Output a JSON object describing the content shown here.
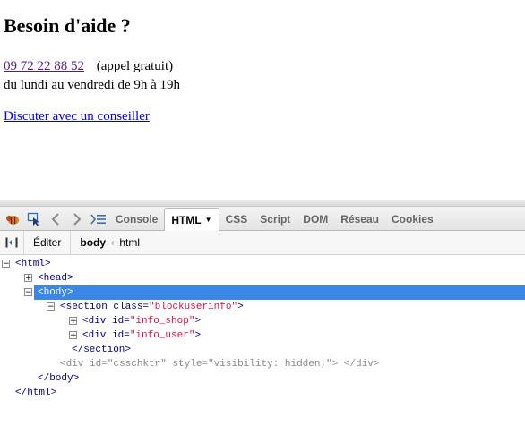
{
  "page": {
    "heading": "Besoin d'aide ?",
    "phone": "09 72 22 88 52",
    "phone_note": "(appel gratuit)",
    "hours": "du lundi au vendredi de 9h à 19h",
    "chat_link": "Discuter avec un conseiller"
  },
  "devtools": {
    "tabs": [
      {
        "label": "Console",
        "active": false
      },
      {
        "label": "HTML",
        "active": true
      },
      {
        "label": "CSS",
        "active": false
      },
      {
        "label": "Script",
        "active": false
      },
      {
        "label": "DOM",
        "active": false
      },
      {
        "label": "Réseau",
        "active": false
      },
      {
        "label": "Cookies",
        "active": false
      }
    ],
    "edit_label": "Éditer",
    "breadcrumbs": {
      "current": "body",
      "parent": "html"
    },
    "tree": {
      "html_open": "<html>",
      "head": "<head>",
      "body_open": "<body>",
      "section_open": "<section",
      "section_attr": "class=",
      "section_val": "\"blockuserinfo\"",
      "section_close_bracket": ">",
      "div": "<div",
      "id_attr": "id=",
      "info_shop": "\"info_shop\"",
      "info_user": "\"info_user\"",
      "section_close": "</section>",
      "csschktr_open": "<div",
      "csschktr_id": "\"csschktr\"",
      "style_attr": "style=",
      "style_val": "\"visibility: hidden;\"",
      "csschktr_end": "> </div>",
      "body_close": "</body>",
      "html_close": "</html>"
    }
  }
}
